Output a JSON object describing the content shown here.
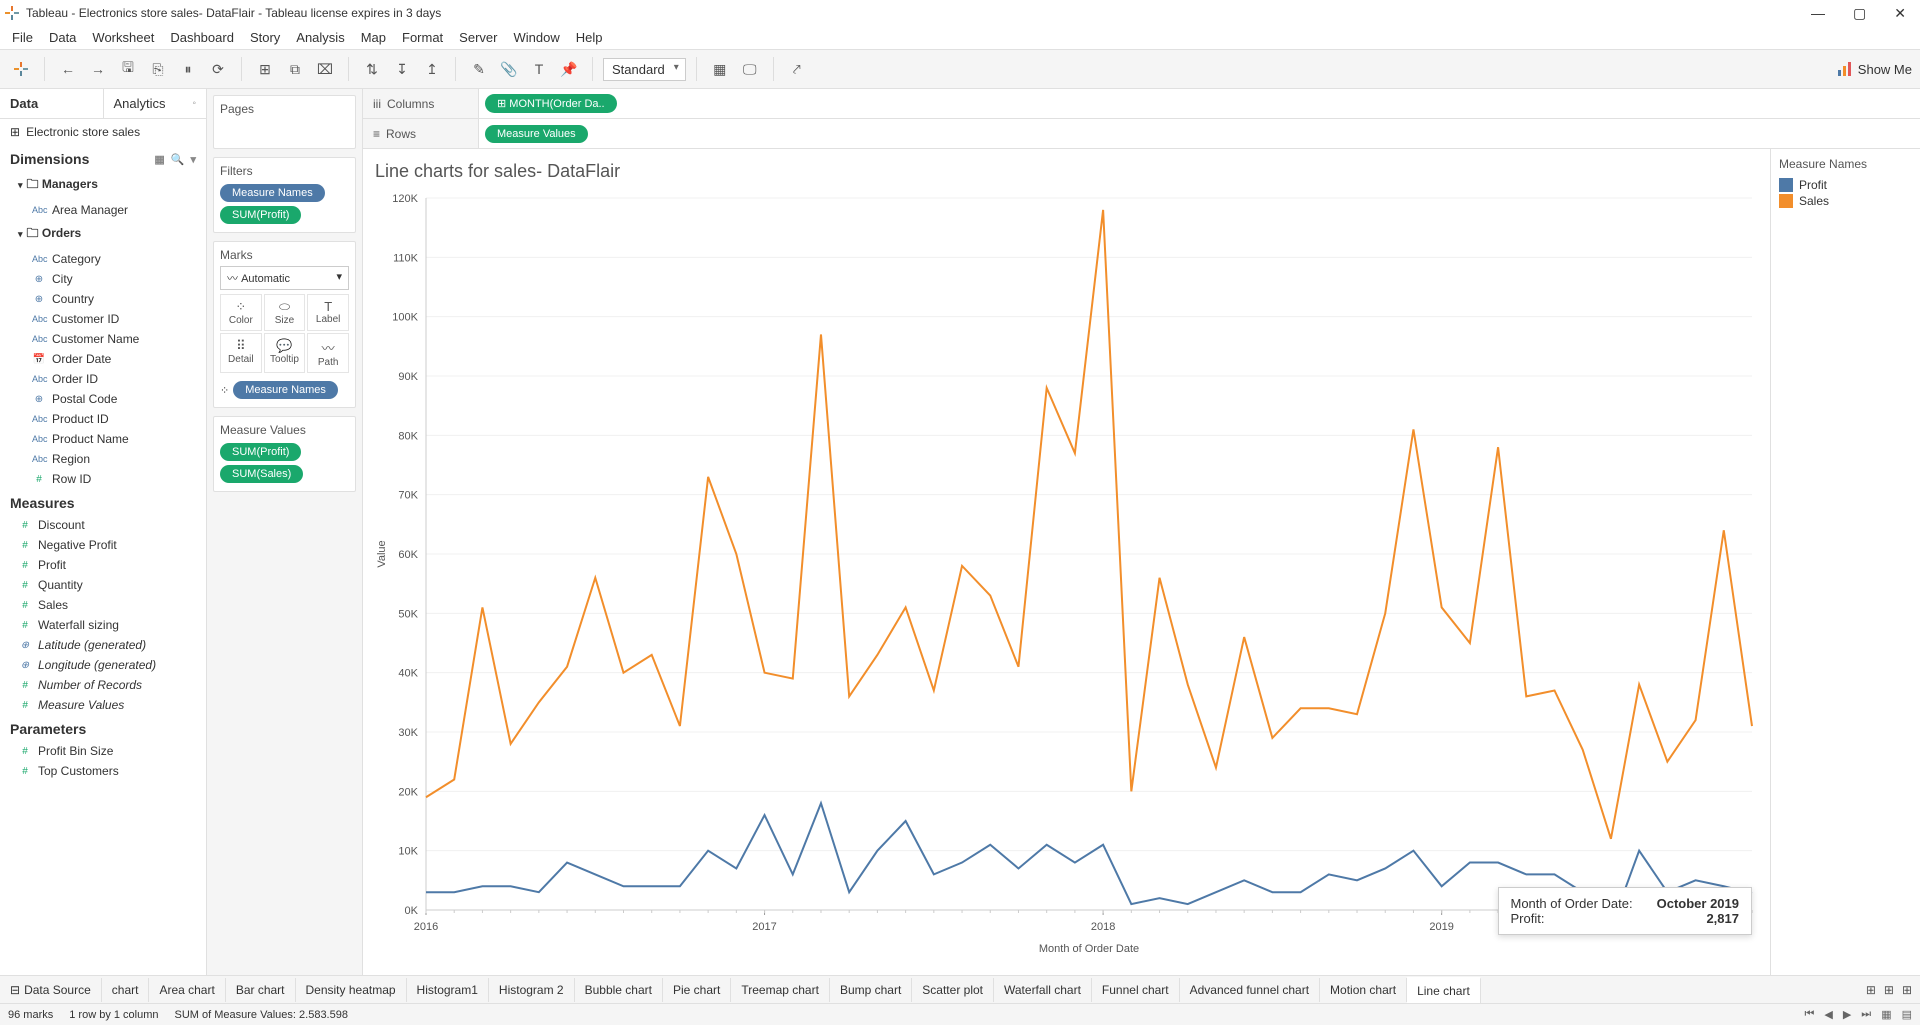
{
  "window": {
    "title": "Tableau - Electronics store sales- DataFlair - Tableau license expires in 3 days"
  },
  "menu": [
    "File",
    "Data",
    "Worksheet",
    "Dashboard",
    "Story",
    "Analysis",
    "Map",
    "Format",
    "Server",
    "Window",
    "Help"
  ],
  "toolbar": {
    "fit": "Standard",
    "showme": "Show Me"
  },
  "data_pane": {
    "tabs": {
      "data": "Data",
      "analytics": "Analytics"
    },
    "source": "Electronic store sales",
    "dimensions_label": "Dimensions",
    "measures_label": "Measures",
    "parameters_label": "Parameters",
    "folders": [
      {
        "name": "Managers",
        "fields": [
          {
            "icon": "abc",
            "label": "Area Manager"
          }
        ]
      },
      {
        "name": "Orders",
        "fields": [
          {
            "icon": "abc",
            "label": "Category"
          },
          {
            "icon": "globe",
            "label": "City"
          },
          {
            "icon": "globe",
            "label": "Country"
          },
          {
            "icon": "abc",
            "label": "Customer ID"
          },
          {
            "icon": "abc",
            "label": "Customer Name"
          },
          {
            "icon": "date",
            "label": "Order Date"
          },
          {
            "icon": "abc",
            "label": "Order ID"
          },
          {
            "icon": "globe",
            "label": "Postal Code"
          },
          {
            "icon": "abc",
            "label": "Product ID"
          },
          {
            "icon": "abc",
            "label": "Product Name"
          },
          {
            "icon": "abc",
            "label": "Region"
          },
          {
            "icon": "num",
            "label": "Row ID"
          }
        ]
      }
    ],
    "measures": [
      {
        "icon": "num",
        "label": "Discount"
      },
      {
        "icon": "num",
        "label": "Negative Profit"
      },
      {
        "icon": "num",
        "label": "Profit"
      },
      {
        "icon": "num",
        "label": "Quantity"
      },
      {
        "icon": "num",
        "label": "Sales"
      },
      {
        "icon": "num",
        "label": "Waterfall sizing"
      },
      {
        "icon": "globe",
        "label": "Latitude (generated)",
        "italic": true
      },
      {
        "icon": "globe",
        "label": "Longitude (generated)",
        "italic": true
      },
      {
        "icon": "num",
        "label": "Number of Records",
        "italic": true
      },
      {
        "icon": "num",
        "label": "Measure Values",
        "italic": true
      }
    ],
    "parameters": [
      {
        "icon": "num",
        "label": "Profit Bin Size"
      },
      {
        "icon": "num",
        "label": "Top Customers"
      }
    ]
  },
  "shelves": {
    "pages": "Pages",
    "filters": "Filters",
    "filter_pills": [
      "Measure Names",
      "SUM(Profit)"
    ],
    "marks": "Marks",
    "mark_type": "Automatic",
    "mark_cells": [
      "Color",
      "Size",
      "Label",
      "Detail",
      "Tooltip",
      "Path"
    ],
    "mark_pill": "Measure Names",
    "mv_label": "Measure Values",
    "mv_pills": [
      "SUM(Profit)",
      "SUM(Sales)"
    ]
  },
  "colrow": {
    "columns_label": "Columns",
    "columns_pill": "MONTH(Order Da..",
    "rows_label": "Rows",
    "rows_pill": "Measure Values"
  },
  "viz": {
    "title": "Line charts for sales- DataFlair",
    "legend_title": "Measure Names",
    "legend": [
      {
        "color": "#4e79a7",
        "label": "Profit"
      },
      {
        "color": "#f28e2b",
        "label": "Sales"
      }
    ]
  },
  "tooltip": {
    "k1": "Month of Order Date:",
    "v1": "October 2019",
    "k2": "Profit:",
    "v2": "2,817"
  },
  "sheet_tabs": [
    "Data Source",
    "chart",
    "Area chart",
    "Bar chart",
    "Density heatmap",
    "Histogram1",
    "Histogram 2",
    "Bubble chart",
    "Pie chart",
    "Treemap chart",
    "Bump chart",
    "Scatter plot",
    "Waterfall chart",
    "Funnel chart",
    "Advanced funnel chart",
    "Motion chart",
    "Line chart"
  ],
  "active_tab": "Line chart",
  "status": {
    "marks": "96 marks",
    "rows": "1 row by 1 column",
    "sum": "SUM of Measure Values: 2.583.598"
  },
  "chart_data": {
    "type": "line",
    "title": "Line charts for sales- DataFlair",
    "xlabel": "Month of Order Date",
    "ylabel": "Value",
    "ylim": [
      0,
      120000
    ],
    "yticks": [
      0,
      10000,
      20000,
      30000,
      40000,
      50000,
      60000,
      70000,
      80000,
      90000,
      100000,
      110000,
      120000
    ],
    "ytick_labels": [
      "0K",
      "10K",
      "20K",
      "30K",
      "40K",
      "50K",
      "60K",
      "70K",
      "80K",
      "90K",
      "100K",
      "110K",
      "120K"
    ],
    "x": [
      0,
      1,
      2,
      3,
      4,
      5,
      6,
      7,
      8,
      9,
      10,
      11,
      12,
      13,
      14,
      15,
      16,
      17,
      18,
      19,
      20,
      21,
      22,
      23,
      24,
      25,
      26,
      27,
      28,
      29,
      30,
      31,
      32,
      33,
      34,
      35,
      36,
      37,
      38,
      39,
      40,
      41,
      42,
      43,
      44,
      45,
      46,
      47
    ],
    "x_year_ticks": {
      "positions": [
        0,
        12,
        24,
        36
      ],
      "labels": [
        "2016",
        "2017",
        "2018",
        "2019"
      ]
    },
    "series": [
      {
        "name": "Sales",
        "color": "#f28e2b",
        "values": [
          19000,
          22000,
          51000,
          28000,
          35000,
          41000,
          56000,
          40000,
          43000,
          31000,
          73000,
          60000,
          40000,
          39000,
          97000,
          36000,
          43000,
          51000,
          37000,
          58000,
          53000,
          41000,
          88000,
          77000,
          118000,
          20000,
          56000,
          38000,
          24000,
          46000,
          29000,
          34000,
          34000,
          33000,
          50000,
          81000,
          51000,
          45000,
          78000,
          36000,
          37000,
          27000,
          12000,
          38000,
          25000,
          32000,
          64000,
          31000
        ]
      },
      {
        "name": "Profit",
        "color": "#4e79a7",
        "values": [
          3000,
          3000,
          4000,
          4000,
          3000,
          8000,
          6000,
          4000,
          4000,
          4000,
          10000,
          7000,
          16000,
          6000,
          18000,
          3000,
          10000,
          15000,
          6000,
          8000,
          11000,
          7000,
          11000,
          8000,
          11000,
          1000,
          2000,
          1000,
          3000,
          5000,
          3000,
          3000,
          6000,
          5000,
          7000,
          10000,
          4000,
          8000,
          8000,
          6000,
          6000,
          3000,
          -3000,
          10000,
          3000,
          5000,
          4000,
          2817
        ]
      }
    ]
  }
}
